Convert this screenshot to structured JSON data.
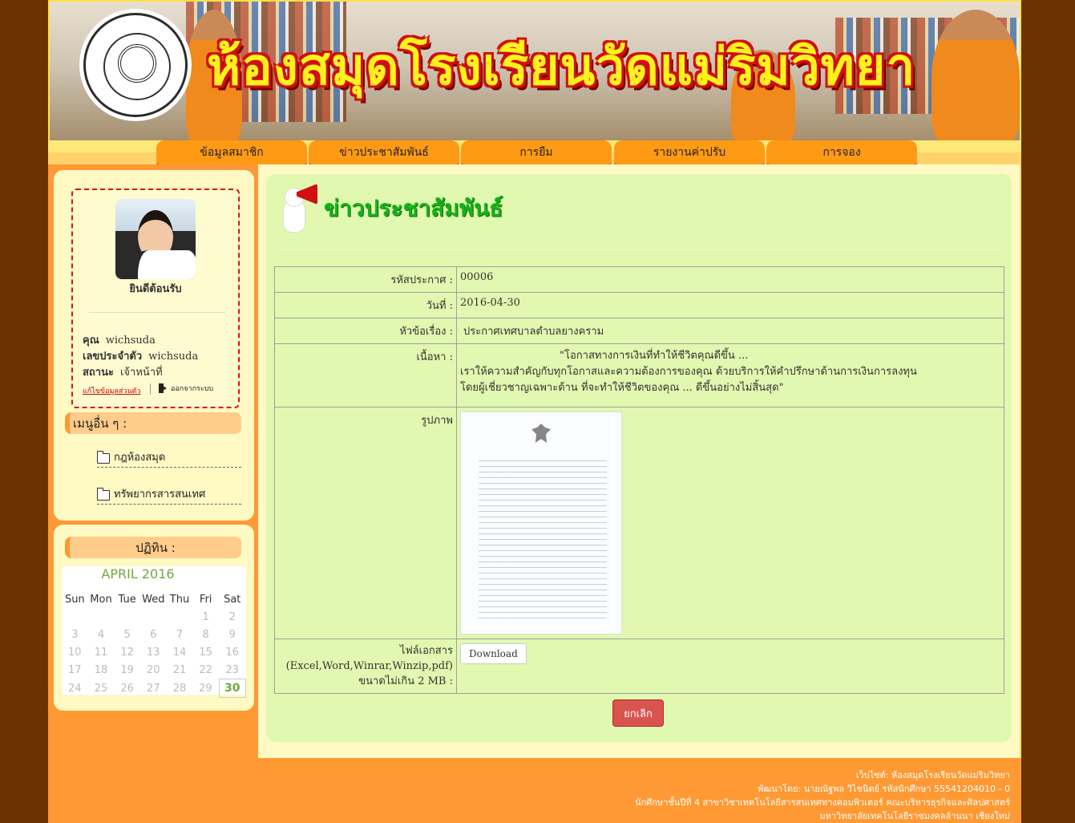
{
  "banner": {
    "title": "ห้องสมุดโรงเรียนวัดแม่ริมวิทยา"
  },
  "nav": {
    "items": [
      "ข้อมูลสมาชิก",
      "ข่าวประชาสัมพันธ์",
      "การยืม",
      "รายงานค่าปรับ",
      "การจอง"
    ]
  },
  "profile": {
    "welcome": "ยินดีต้อนรับ",
    "name_label": "คุณ",
    "name_value": "wichsuda",
    "id_label": "เลขประจำตัว",
    "id_value": "wichsuda",
    "status_label": "สถานะ",
    "status_value": "เจ้าหน้าที่",
    "edit_link": "แก้ไขข้อมูลส่วนตัว",
    "logout": "ออกจากระบบ"
  },
  "other_menu": {
    "heading": "เมนูอื่น ๆ :",
    "items": [
      "กฎห้องสมุด",
      "ทรัพยากรสารสนเทศ"
    ]
  },
  "calendar": {
    "heading": "ปฏิทิน :",
    "month": "APRIL 2016",
    "dow": [
      "Sun",
      "Mon",
      "Tue",
      "Wed",
      "Thu",
      "Fri",
      "Sat"
    ],
    "weeks": [
      [
        "",
        "",
        "",
        "",
        "",
        "1",
        "2"
      ],
      [
        "3",
        "4",
        "5",
        "6",
        "7",
        "8",
        "9"
      ],
      [
        "10",
        "11",
        "12",
        "13",
        "14",
        "15",
        "16"
      ],
      [
        "17",
        "18",
        "19",
        "20",
        "21",
        "22",
        "23"
      ],
      [
        "24",
        "25",
        "26",
        "27",
        "28",
        "29",
        "30"
      ]
    ],
    "today": "30"
  },
  "page": {
    "title": "ข่าวประชาสัมพันธ์"
  },
  "detail": {
    "code_label": "รหัสประกาศ :",
    "code_value": "00006",
    "date_label": "วันที่ :",
    "date_value": "2016-04-30",
    "subject_label": "หัวข้อเรื่อง :",
    "subject_value": "ประกาศเทศบาลตำบลยางคราม",
    "content_label": "เนื้อหา :",
    "content_line1": "\"โอกาสทางการเงินที่ทำให้ชีวิตคุณดีขึ้น ...",
    "content_line2": "เราให้ความสำคัญกับทุกโอกาสและความต้องการของคุณ ด้วยบริการให้คำปรึกษาด้านการเงินการลงทุน",
    "content_line3": "โดยผู้เชี่ยวชาญเฉพาะด้าน ที่จะทำให้ชีวิตของคุณ ... ดีขึ้นอย่างไม่สิ้นสุด\"",
    "image_label": "รูปภาพ",
    "file_label_1": "ไฟล์เอกสาร",
    "file_label_2": "(Excel,Word,Winrar,Winzip,pdf)",
    "file_label_3": "ขนาดไม่เกิน 2 MB :",
    "download_label": "Download"
  },
  "cancel_label": "ยกเลิก",
  "footer": {
    "line1": "เว็บไซต์: ห้องสมุดโรงเรียนวัดแม่ริมวิทยา",
    "line2": "พัฒนาโดย: นายณัฐพล วิไชนิตย์ รหัสนักศึกษา 55541204010 - 0",
    "line3": "นักศึกษาชั้นปีที่ 4 สาขาวิชาเทคโนโลยีสารสนเทศทางคอมพิวเตอร์ คณะบริหารธุรกิจและศิลปศาสตร์",
    "line4": "มหาวิทยาลัยเทคโนโลยีราชมงคลล้านนา เชียงใหม่"
  },
  "colors": {
    "page_bg": "#6b3301",
    "nav_orange": "#ff9a14",
    "panel_green": "#e1f8b0",
    "title_green": "#18b318",
    "cancel_red": "#d9534f"
  }
}
